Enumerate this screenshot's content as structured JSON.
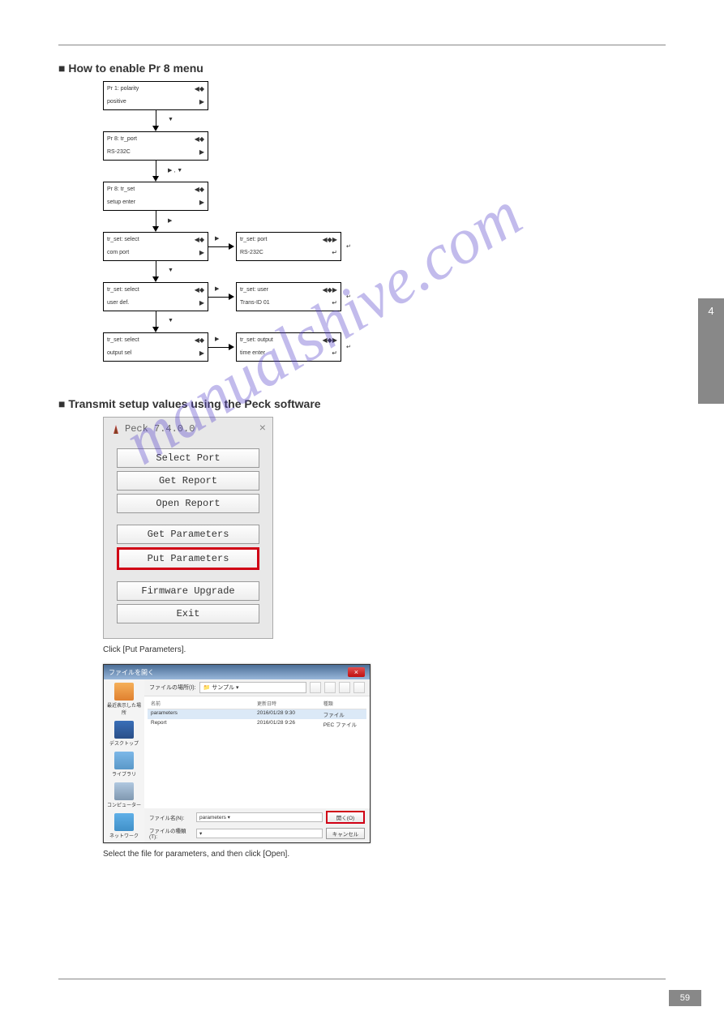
{
  "header": {
    "chapter_label": "4"
  },
  "sections": {
    "flow_title": "■ How to enable Pr 8 menu",
    "peck_title": "■ Transmit setup values using the Peck software"
  },
  "flow": {
    "boxes": [
      {
        "top": "Pr 1:  polarity",
        "bot": "positive",
        "sym_top": "◀◆",
        "sym_bot": "▶"
      },
      {
        "top": "Pr 8:  tr_port",
        "bot": "RS-232C",
        "sym_top": "◀◆",
        "sym_bot": "▶"
      },
      {
        "top": "Pr 8:  tr_set",
        "bot": "setup  enter",
        "sym_top": "◀◆",
        "sym_bot": "▶"
      },
      {
        "top": "tr_set:  select",
        "bot": "com  port",
        "sym_top": "◀◆",
        "sym_bot": "▶"
      },
      {
        "top": "tr_set:  select",
        "bot": "user  def.",
        "sym_top": "◀◆",
        "sym_bot": "▶"
      },
      {
        "top": "tr_set:  select",
        "bot": "output  sel",
        "sym_top": "◀◆",
        "sym_bot": "▶"
      },
      {
        "top": "tr_set:  port",
        "bot": "RS-232C",
        "sym_top": "◀◆▶",
        "sym_bot": "↵"
      },
      {
        "top": "tr_set:  user",
        "bot": "Trans-ID  01",
        "sym_top": "◀◆▶",
        "sym_bot": "↵"
      },
      {
        "top": "tr_set:  output",
        "bot": "time  enter",
        "sym_top": "◀◆▶",
        "sym_bot": "↵"
      }
    ],
    "annotations": {
      "a1": "▼",
      "a2": "▶ , ▼",
      "a3": "▶",
      "a4": "▼",
      "a5": "▶",
      "a6": "▼",
      "a7": "▶",
      "a8": "↵",
      "a9": "↵",
      "a10": "↵"
    }
  },
  "peck": {
    "title": "Peck 7.4.0.0",
    "buttons": {
      "select_port": "Select Port",
      "get_report": "Get Report",
      "open_report": "Open Report",
      "get_params": "Get Parameters",
      "put_params": "Put Parameters",
      "firmware": "Firmware Upgrade",
      "exit": "Exit"
    },
    "caption": "Click [Put Parameters]."
  },
  "file_dialog": {
    "title": "ファイルを開く",
    "path_label": "ファイルの場所(I):",
    "path_value": "サンプル",
    "sidebar": [
      "最近表示した場所",
      "デスクトップ",
      "ライブラリ",
      "コンピューター",
      "ネットワーク"
    ],
    "list_head": {
      "name": "名前",
      "date": "更新日時",
      "type": "種類"
    },
    "rows": [
      {
        "name": "parameters",
        "date": "2016/01/28 9:30",
        "type": "ファイル",
        "selected": true
      },
      {
        "name": "Report",
        "date": "2016/01/28 9:26",
        "type": "PEC ファイル",
        "selected": false
      }
    ],
    "filename_label": "ファイル名(N):",
    "filename_value": "parameters",
    "filetype_label": "ファイルの種類(T):",
    "filetype_value": "",
    "open_btn": "開く(O)",
    "cancel_btn": "キャンセル",
    "caption": "Select the file for parameters, and then click [Open]."
  },
  "footer": {
    "page": "59"
  },
  "watermark": "manualshive.com"
}
